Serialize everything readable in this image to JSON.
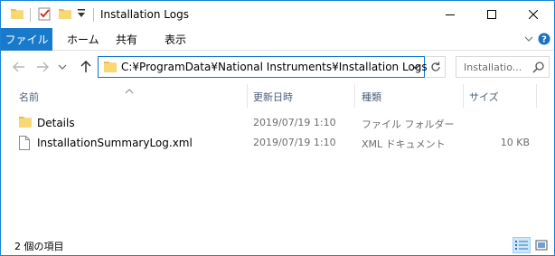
{
  "window": {
    "title": "Installation Logs",
    "accent": "#1979ca",
    "border": "#1883d7"
  },
  "quick_access": {
    "icons": [
      "folder-icon",
      "properties-icon",
      "new-folder-icon",
      "dropdown-icon"
    ]
  },
  "window_controls": {
    "minimize": "minimize-icon",
    "maximize": "maximize-icon",
    "close": "close-icon"
  },
  "ribbon": {
    "file_tab": "ファイル",
    "tabs": [
      "ホーム",
      "共有",
      "表示"
    ],
    "expand_icon": "chevron-down-icon",
    "help_icon": "help-icon"
  },
  "nav": {
    "back_icon": "back-arrow-icon",
    "forward_icon": "forward-arrow-icon",
    "recent_icon": "chevron-down-icon",
    "up_icon": "up-arrow-icon",
    "address": "C:¥ProgramData¥National Instruments¥Installation Logs",
    "refresh_icon": "refresh-icon",
    "search_placeholder": "Installatio...",
    "search_icon": "search-icon"
  },
  "columns": {
    "name": "名前",
    "modified": "更新日時",
    "type": "種類",
    "size": "サイズ"
  },
  "files": [
    {
      "name": "Details",
      "modified": "2019/07/19 1:10",
      "type": "ファイル フォルダー",
      "size": "",
      "icon": "folder-icon"
    },
    {
      "name": "InstallationSummaryLog.xml",
      "modified": "2019/07/19 1:10",
      "type": "XML ドキュメント",
      "size": "10 KB",
      "icon": "document-icon"
    }
  ],
  "status": {
    "item_count": "2 個の項目"
  },
  "views": {
    "details_icon": "details-view-icon",
    "large_icon": "large-icons-view-icon"
  }
}
